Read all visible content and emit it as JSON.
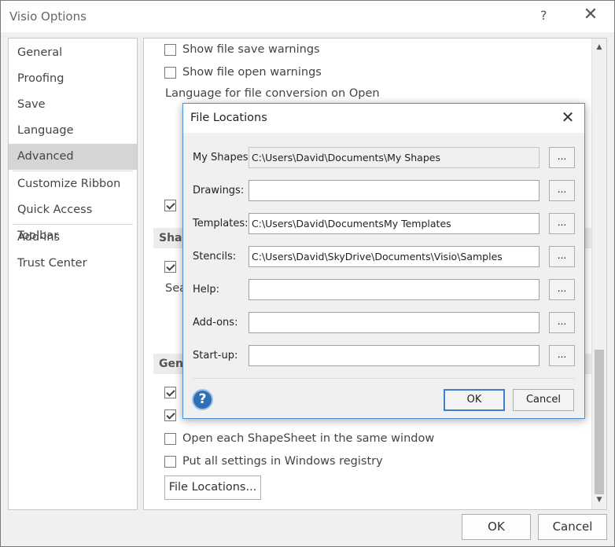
{
  "window": {
    "title": "Visio Options",
    "help_glyph": "?",
    "close_glyph": "✕"
  },
  "nav": {
    "items": [
      {
        "label": "General"
      },
      {
        "label": "Proofing"
      },
      {
        "label": "Save"
      },
      {
        "label": "Language"
      },
      {
        "label": "Advanced",
        "active": true
      },
      {
        "label": "Customize Ribbon"
      },
      {
        "label": "Quick Access Toolbar"
      },
      {
        "label": "Add-ins"
      },
      {
        "label": "Trust Center"
      }
    ]
  },
  "content": {
    "options_top": [
      {
        "label": "Show file save warnings",
        "checked": false
      },
      {
        "label": "Show file open warnings",
        "checked": false
      }
    ],
    "language_heading": "Language for file conversion on Open",
    "section_shape_partial": "Shap",
    "search_partial": "Sea",
    "section_general_partial": "Gene",
    "options_bottom": [
      {
        "label": "Open each ShapeSheet in the same window",
        "checked": false
      },
      {
        "label": "Put all settings in Windows registry",
        "checked": false
      }
    ],
    "file_locations_button": "File Locations..."
  },
  "footer": {
    "ok": "OK",
    "cancel": "Cancel"
  },
  "dialog": {
    "title": "File Locations",
    "close_glyph": "✕",
    "rows": [
      {
        "label": "My Shapes:",
        "value": "C:\\Users\\David\\Documents\\My Shapes",
        "readonly": true
      },
      {
        "label": "Drawings:",
        "value": ""
      },
      {
        "label": "Templates:",
        "value": "C:\\Users\\David\\DocumentsMy Templates"
      },
      {
        "label": "Stencils:",
        "value": "C:\\Users\\David\\SkyDrive\\Documents\\Visio\\Samples"
      },
      {
        "label": "Help:",
        "value": ""
      },
      {
        "label": "Add-ons:",
        "value": ""
      },
      {
        "label": "Start-up:",
        "value": ""
      }
    ],
    "browse_label": "...",
    "help_glyph": "?",
    "ok": "OK",
    "cancel": "Cancel"
  },
  "colors": {
    "accent": "#3c7fd0",
    "selected_nav": "#d5d5d5",
    "help_icon": "#2f6fb5"
  }
}
